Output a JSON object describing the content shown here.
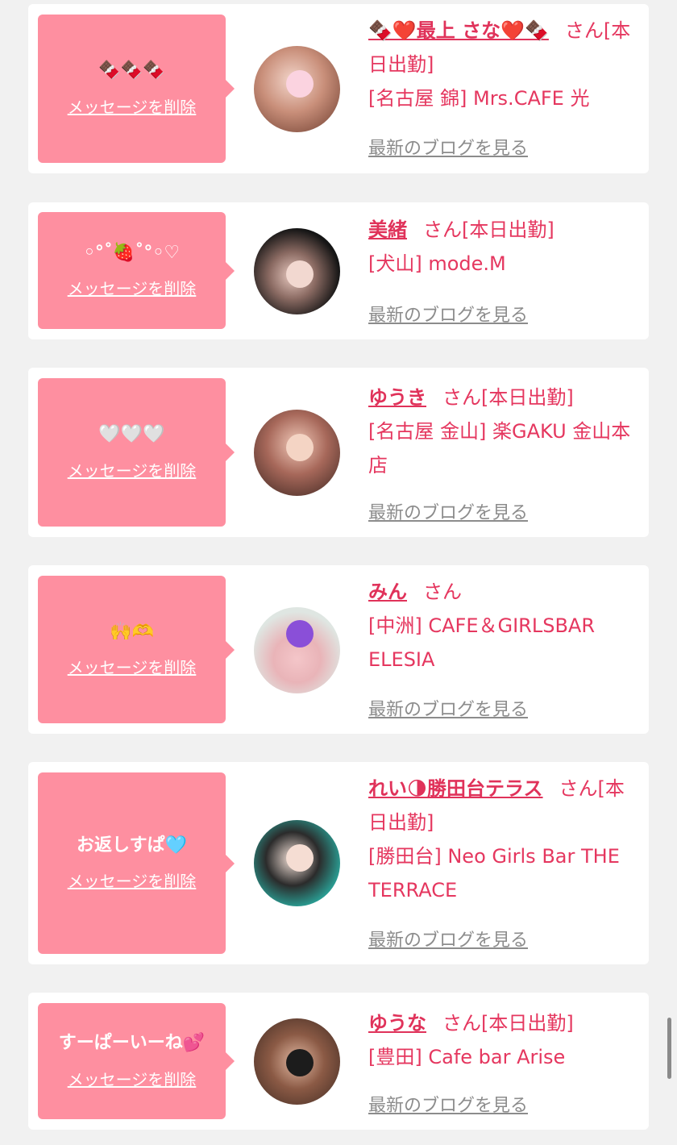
{
  "delete_label": "メッセージを削除",
  "blog_label": "最新のブログを見る",
  "san_label": "さん",
  "items": [
    {
      "message": "🍫🍫🍫",
      "name": "🍫❤️最上 さな❤️🍫",
      "status": "[本日出勤]",
      "shop": "[名古屋 錦] Mrs.CAFE 光"
    },
    {
      "message": "◦°˚🍓˚°◦♡",
      "name": "美緒",
      "status": "[本日出勤]",
      "shop": "[犬山] mode.M"
    },
    {
      "message": "🤍🤍🤍",
      "name": "ゆうき",
      "status": "[本日出勤]",
      "shop": "[名古屋 金山] 楽GAKU 金山本店"
    },
    {
      "message": "🙌🫶",
      "name": "みん",
      "status": "",
      "shop": "[中洲] CAFE＆GIRLSBAR ELESIA"
    },
    {
      "message": "お返しすぱ🩵",
      "name": "れい🌗勝田台テラス",
      "status": "[本日出勤]",
      "shop": "[勝田台] Neo Girls Bar THE TERRACE"
    },
    {
      "message": "すーぱーいーね💕",
      "name": "ゆうな",
      "status": "[本日出勤]",
      "shop": "[豊田] Cafe bar Arise"
    }
  ],
  "colors": {
    "bubble": "#fe8fa0",
    "accent": "#e5375f",
    "link_gray": "#8c8c8c",
    "background": "#f1f1f1"
  }
}
